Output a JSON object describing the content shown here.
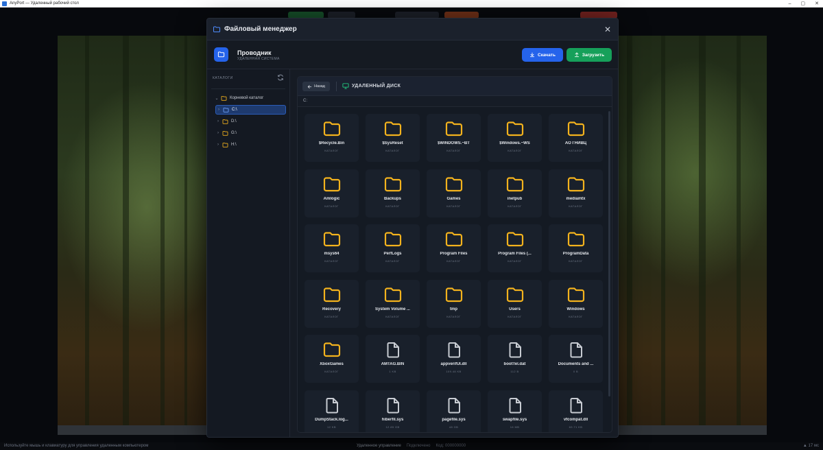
{
  "window": {
    "title": "AnyPort — Удаленный рабочий стол",
    "controls": [
      "–",
      "▢",
      "✕"
    ]
  },
  "modal": {
    "title": "Файловый менеджер",
    "app_name": "Проводник",
    "app_subtitle": "Удаленная система",
    "download_label": "Скачать",
    "upload_label": "Загрузить"
  },
  "sidebar": {
    "heading": "Каталоги",
    "root_label": "Корневой каталог",
    "drives": [
      {
        "label": "C:\\",
        "selected": true
      },
      {
        "label": "D:\\",
        "selected": false
      },
      {
        "label": "G:\\",
        "selected": false
      },
      {
        "label": "H:\\",
        "selected": false
      }
    ]
  },
  "pathbar": {
    "back_label": "Назад",
    "location_label": "Удаленный диск",
    "address": "C:"
  },
  "items": [
    {
      "name": "$Recycle.Bin",
      "meta": "Каталог",
      "kind": "folder"
    },
    {
      "name": "$SysReset",
      "meta": "Каталог",
      "kind": "folder"
    },
    {
      "name": "$WINDOWS.~BT",
      "meta": "Каталог",
      "kind": "folder"
    },
    {
      "name": "$Windows.~WS",
      "meta": "Каталог",
      "kind": "folder"
    },
    {
      "name": "АО ГНИВЦ",
      "meta": "Каталог",
      "kind": "folder"
    },
    {
      "name": "Amlogic",
      "meta": "Каталог",
      "kind": "folder"
    },
    {
      "name": "Backups",
      "meta": "Каталог",
      "kind": "folder"
    },
    {
      "name": "Games",
      "meta": "Каталог",
      "kind": "folder"
    },
    {
      "name": "inetpub",
      "meta": "Каталог",
      "kind": "folder"
    },
    {
      "name": "mediamtx",
      "meta": "Каталог",
      "kind": "folder"
    },
    {
      "name": "msys64",
      "meta": "Каталог",
      "kind": "folder"
    },
    {
      "name": "PerfLogs",
      "meta": "Каталог",
      "kind": "folder"
    },
    {
      "name": "Program Files",
      "meta": "Каталог",
      "kind": "folder"
    },
    {
      "name": "Program Files (...",
      "meta": "Каталог",
      "kind": "folder"
    },
    {
      "name": "ProgramData",
      "meta": "Каталог",
      "kind": "folder"
    },
    {
      "name": "Recovery",
      "meta": "Каталог",
      "kind": "folder"
    },
    {
      "name": "System Volume ...",
      "meta": "Каталог",
      "kind": "folder"
    },
    {
      "name": "tmp",
      "meta": "Каталог",
      "kind": "folder"
    },
    {
      "name": "Users",
      "meta": "Каталог",
      "kind": "folder"
    },
    {
      "name": "Windows",
      "meta": "Каталог",
      "kind": "folder"
    },
    {
      "name": "XboxGames",
      "meta": "Каталог",
      "kind": "folder"
    },
    {
      "name": "AMTAG.BIN",
      "meta": "1 KB",
      "kind": "file"
    },
    {
      "name": "appverifUI.dll",
      "meta": "109.48 KB",
      "kind": "file"
    },
    {
      "name": "bootTel.dat",
      "meta": "112 B",
      "kind": "file"
    },
    {
      "name": "Documents and ...",
      "meta": "0 B",
      "kind": "file"
    },
    {
      "name": "DumpStack.log...",
      "meta": "12 KB",
      "kind": "file"
    },
    {
      "name": "hiberfil.sys",
      "meta": "12.85 GB",
      "kind": "file"
    },
    {
      "name": "pagefile.sys",
      "meta": "48 GB",
      "kind": "file"
    },
    {
      "name": "swapfile.sys",
      "meta": "16 MB",
      "kind": "file"
    },
    {
      "name": "vfcompat.dll",
      "meta": "69.71 KB",
      "kind": "file"
    }
  ],
  "status_bar": {
    "left": "Используйте мышь и клавиатуру для управления удаленным компьютером",
    "center": [
      "Удаленное управление",
      "Подключено",
      "Код: 000000000"
    ],
    "right": "▲ 17 мс"
  },
  "colors": {
    "accent": "#2563eb",
    "success": "#16a05a",
    "folder": "#f4b31d",
    "file": "#c7cbd2"
  }
}
